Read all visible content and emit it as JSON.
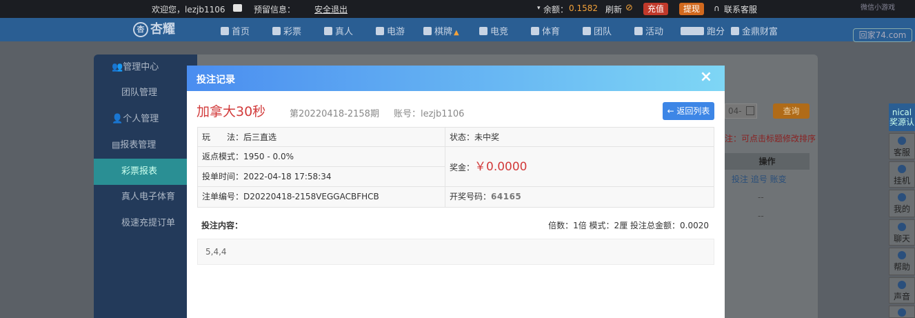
{
  "topbar": {
    "welcome": "欢迎您，lezjb1106",
    "mail_icon": "mail-icon",
    "notice": "预留信息：",
    "logout": "安全退出",
    "balance_label": "余额：",
    "balance_value": "0.1582",
    "refresh": "刷新",
    "deposit": "充值",
    "withdraw": "提现",
    "support": "联系客服"
  },
  "nav": {
    "logo": "杏耀",
    "items": [
      "首页",
      "彩票",
      "真人",
      "电游",
      "棋牌",
      "电竞",
      "体育",
      "团队",
      "活动",
      "跑分",
      "金鼎财富"
    ],
    "watermark_top": "微信小游戏",
    "watermark": "回家74.com"
  },
  "sidebar": {
    "items": [
      "管理中心",
      "团队管理",
      "个人管理",
      "报表管理",
      "彩票报表",
      "真人电子体育",
      "极速充提订单"
    ]
  },
  "background": {
    "date_partial": "04-",
    "query": "查询",
    "note": "注：可点击标题修改排序",
    "op_header": "操作",
    "ops": "投注  追号  账变",
    "dash": "--"
  },
  "rtools": {
    "top": [
      "nical",
      "奖源认"
    ],
    "items": [
      "客服",
      "挂机",
      "我的",
      "聊天",
      "帮助",
      "声音"
    ]
  },
  "modal": {
    "title": "投注记录",
    "close": "×",
    "game": "加拿大30秒",
    "issue": "第20220418-2158期",
    "account": "账号：lezjb1106",
    "back": "← 返回列表",
    "play_label": "玩　　法：",
    "play_value": "后三直选",
    "status_label": "状态：",
    "status_value": "未中奖",
    "rebate_label": "返点模式：",
    "rebate_value": "1950 - 0.0%",
    "prize_label": "奖金：",
    "prize_value": "￥0.0000",
    "time_label": "投单时间：",
    "time_value": "2022-04-18 17:58:34",
    "order_label": "注单编号：",
    "order_value": "D20220418-2158VEGGACBFHCB",
    "draw_label": "开奖号码：",
    "draw_value": "64165",
    "content_label": "投注内容：",
    "summary": "倍数：1倍  模式：2厘  投注总金额：0.0020",
    "content_value": "5,4,4"
  }
}
